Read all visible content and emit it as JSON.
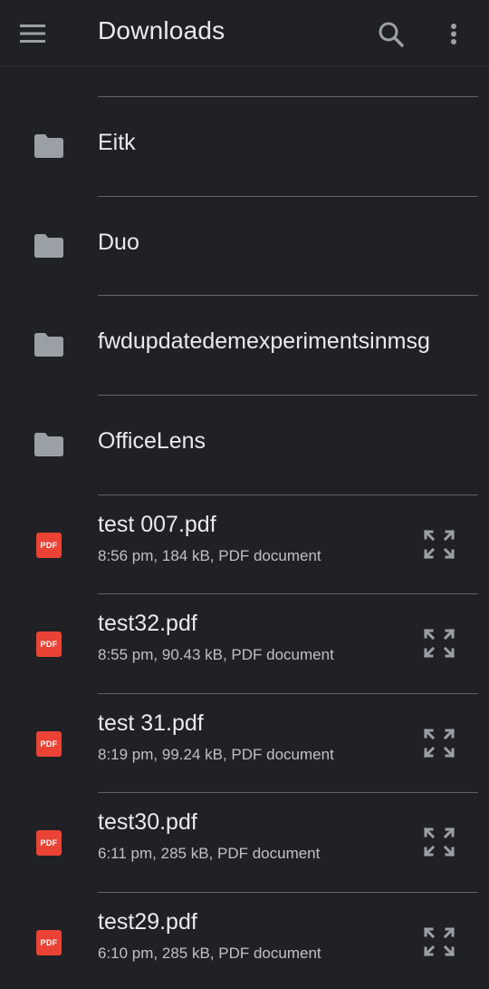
{
  "toolbar": {
    "title": "Downloads",
    "menu_icon": "hamburger-menu-icon",
    "search_icon": "search-icon",
    "more_icon": "more-vert-icon"
  },
  "folders": [
    {
      "name": "Eitk"
    },
    {
      "name": "Duo"
    },
    {
      "name": "fwdupdatedemexperimentsinmsg"
    },
    {
      "name": "OfficeLens"
    }
  ],
  "files": [
    {
      "name": "test 007.pdf",
      "meta": "8:56 pm, 184 kB, PDF document",
      "badge": "PDF"
    },
    {
      "name": "test32.pdf",
      "meta": "8:55 pm, 90.43 kB, PDF document",
      "badge": "PDF"
    },
    {
      "name": "test 31.pdf",
      "meta": "8:19 pm, 99.24 kB, PDF document",
      "badge": "PDF"
    },
    {
      "name": "test30.pdf",
      "meta": "6:11 pm, 285 kB, PDF document",
      "badge": "PDF"
    },
    {
      "name": "test29.pdf",
      "meta": "6:10 pm, 285 kB, PDF document",
      "badge": "PDF"
    }
  ],
  "colors": {
    "background": "#202124",
    "divider": "#5f6368",
    "pdf_badge": "#ea4335",
    "folder_icon": "#9aa0a6",
    "text_primary": "#e8eaed",
    "text_secondary": "#bdc1c6"
  }
}
